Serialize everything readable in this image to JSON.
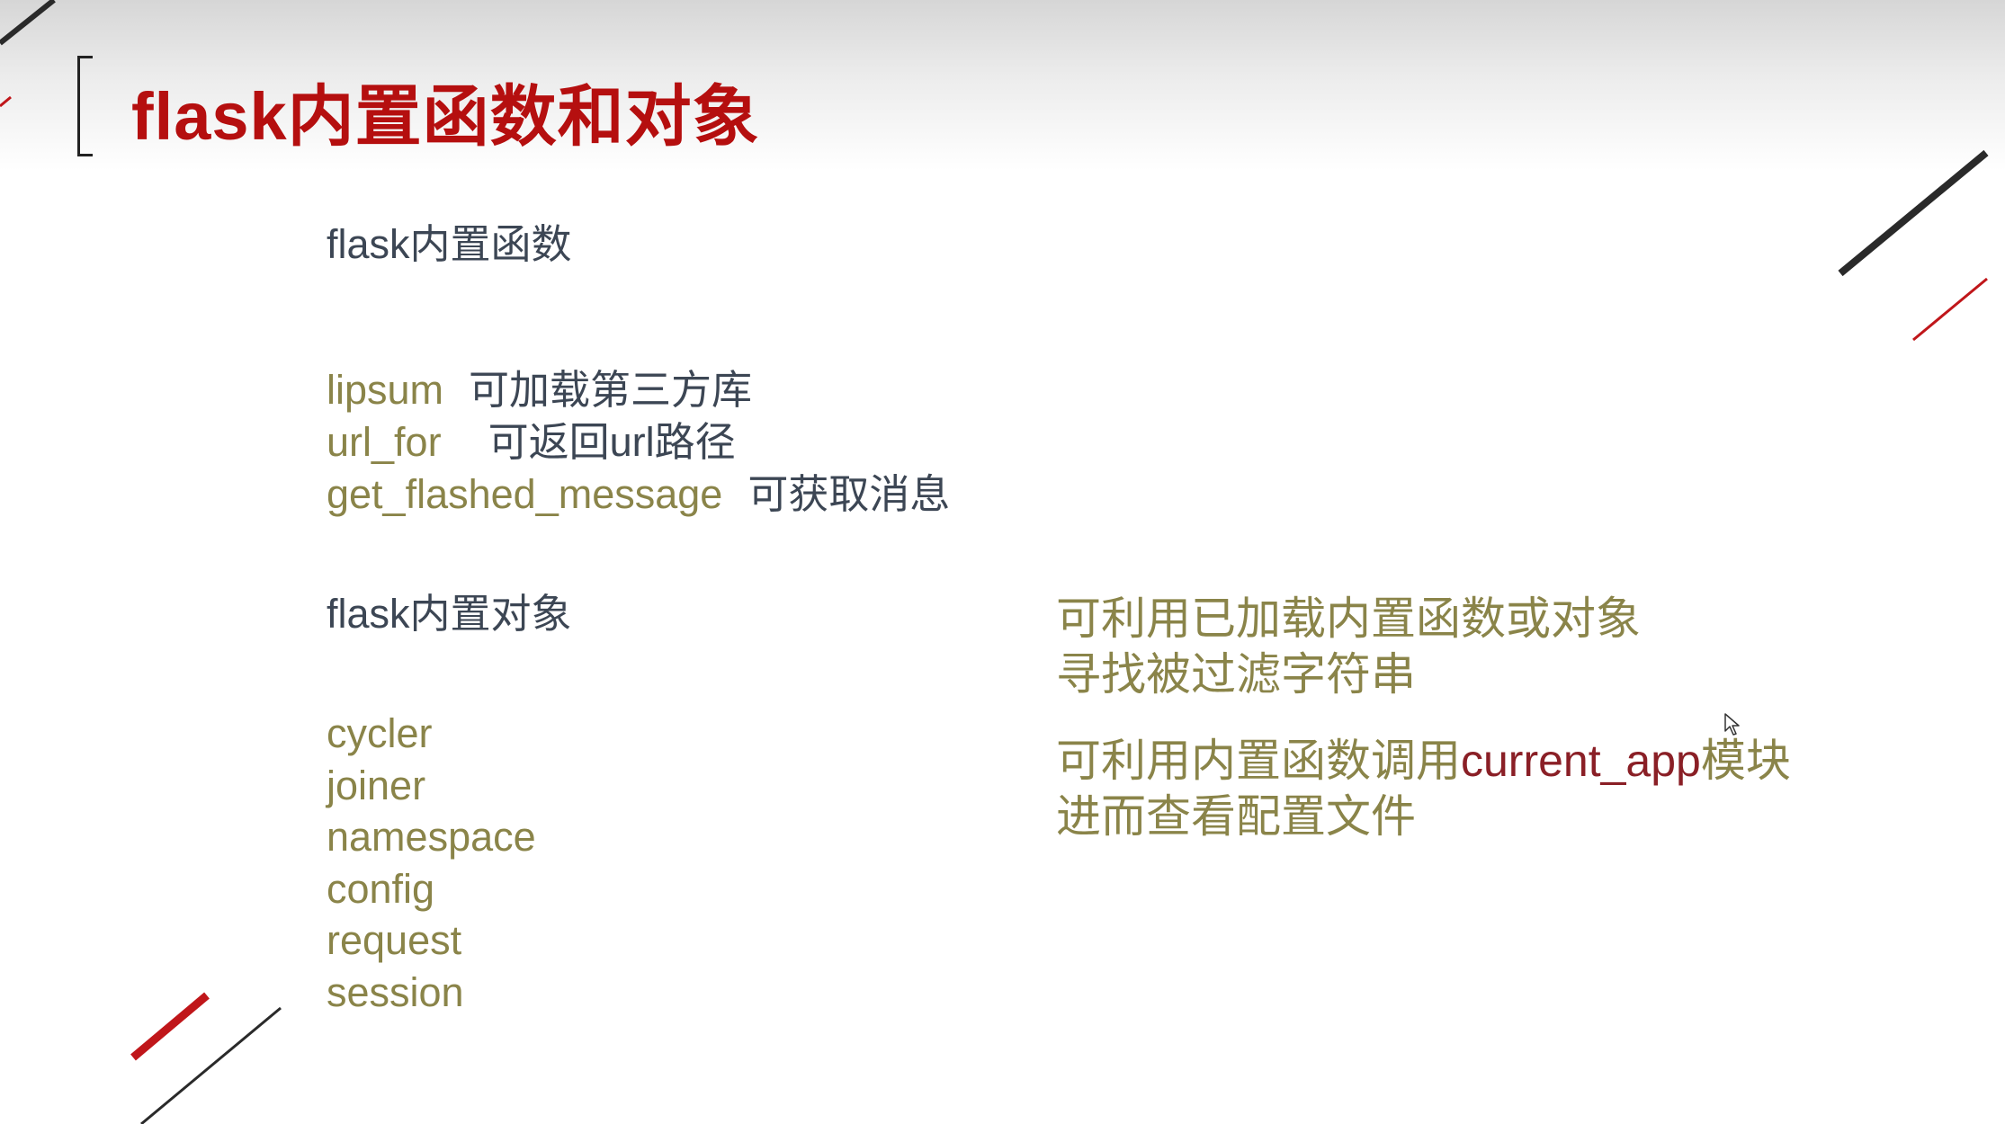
{
  "slide": {
    "title": "flask内置函数和对象",
    "functions_heading": "flask内置函数",
    "functions": [
      {
        "name": "lipsum",
        "desc": "可加载第三方库"
      },
      {
        "name": "url_for",
        "desc": "可返回url路径"
      },
      {
        "name": "get_flashed_message",
        "desc": "可获取消息"
      }
    ],
    "objects_heading": "flask内置对象",
    "objects": [
      "cycler",
      "joiner",
      "namespace",
      "config",
      "request",
      "session"
    ],
    "notes": {
      "note1_line1": "可利用已加载内置函数或对象",
      "note1_line2": "寻找被过滤字符串",
      "note2_line1_a": "可利用内置函数调用",
      "note2_line1_highlight": "current_app",
      "note2_line1_b": "模块",
      "note2_line2": "进而查看配置文件"
    }
  },
  "colors": {
    "title": "#b50f0f",
    "heading": "#3c4654",
    "function_name": "#8a8449",
    "note": "#8a8449",
    "note_highlight": "#8a1f26",
    "accent_red": "#c0161a"
  }
}
